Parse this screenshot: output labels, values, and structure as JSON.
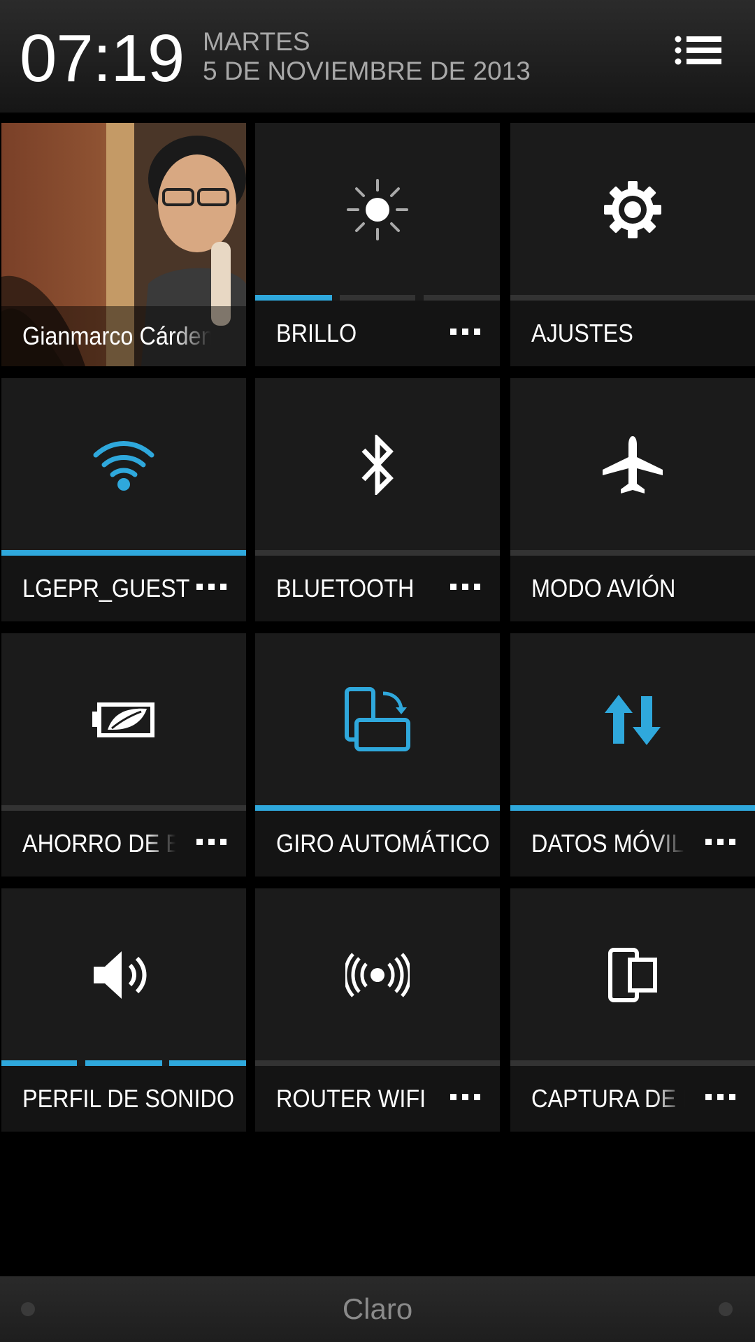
{
  "header": {
    "time": "07:19",
    "day": "MARTES",
    "date": "5 DE NOVIEMBRE DE 2013",
    "menu_icon": "list-menu-icon"
  },
  "contact": {
    "name": "Gianmarco Cárdenas"
  },
  "tiles": [
    {
      "label": "BRILLO",
      "icon": "brightness-icon",
      "more": true,
      "active": false,
      "level": "1 of 3"
    },
    {
      "label": "AJUSTES",
      "icon": "gear-icon",
      "more": false,
      "active": false
    },
    {
      "label": "LGEPR_GUEST",
      "icon": "wifi-icon",
      "more": true,
      "active": true
    },
    {
      "label": "BLUETOOTH",
      "icon": "bluetooth-icon",
      "more": true,
      "active": false
    },
    {
      "label": "MODO AVIÓN",
      "icon": "airplane-icon",
      "more": false,
      "active": false
    },
    {
      "label": "AHORRO DE ENERGÍA",
      "icon": "battery-leaf-icon",
      "more": true,
      "active": false
    },
    {
      "label": "GIRO AUTOMÁTICO",
      "icon": "auto-rotate-icon",
      "more": false,
      "active": true
    },
    {
      "label": "DATOS MÓVILES",
      "icon": "mobile-data-icon",
      "more": true,
      "active": true
    },
    {
      "label": "PERFIL DE SONIDO",
      "icon": "speaker-icon",
      "more": false,
      "active": true,
      "level": "3 of 3"
    },
    {
      "label": "ROUTER WIFI",
      "icon": "hotspot-icon",
      "more": true,
      "active": false
    },
    {
      "label": "CAPTURA DE PANTALLA",
      "icon": "screenshot-icon",
      "more": true,
      "active": false
    }
  ],
  "footer": {
    "carrier": "Claro"
  },
  "colors": {
    "accent": "#2fa8dc",
    "tile_bg": "#1b1b1b",
    "inactive_bar": "#333333"
  }
}
